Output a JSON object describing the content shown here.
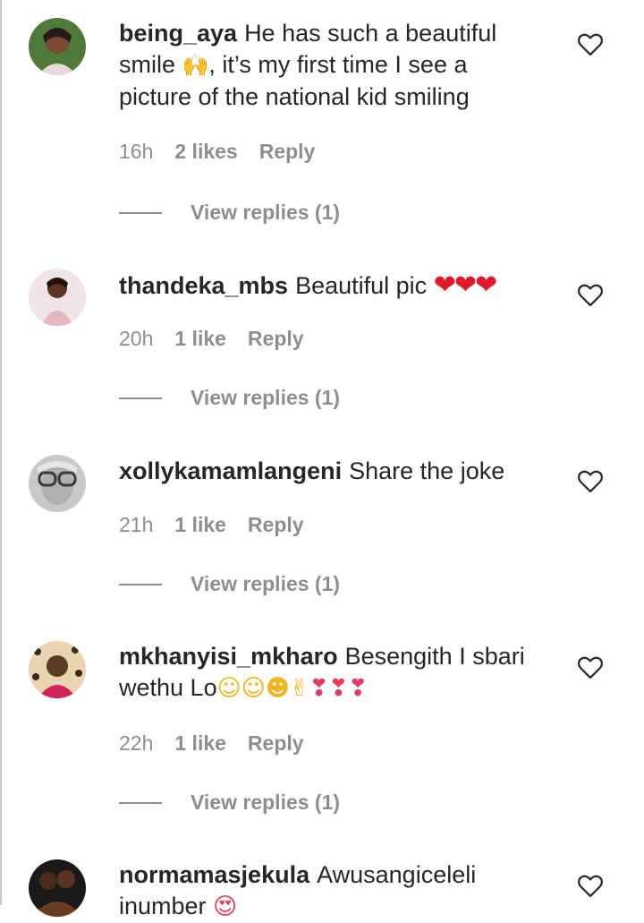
{
  "comments": [
    {
      "username": "being_aya",
      "text_1": "He has such a beautiful smile",
      "emoji": "🙌",
      "text_2": ", it’s my first time I see a picture of the national kid smiling",
      "time": "16h",
      "likes": "2 likes",
      "reply": "Reply",
      "view_replies": "View replies (1)"
    },
    {
      "username": "thandeka_mbs",
      "text_1": "Beautiful pic",
      "emoji": "❤❤❤",
      "time": "20h",
      "likes": "1 like",
      "reply": "Reply",
      "view_replies": "View replies (1)"
    },
    {
      "username": "xollykamamlangeni",
      "text_1": "Share the joke",
      "time": "21h",
      "likes": "1 like",
      "reply": "Reply",
      "view_replies": "View replies (1)"
    },
    {
      "username": "mkhanyisi_mkharo",
      "text_1": "Besengith I sbari wethu Lo",
      "emoji_faces": "☺☺",
      "emoji_laugh": "☻",
      "emoji_hand": "✌",
      "emoji_hearts": "❣❣❣",
      "time": "22h",
      "likes": "1 like",
      "reply": "Reply",
      "view_replies": "View replies (1)"
    },
    {
      "username": "normamasjekula",
      "text_1": "Awusangiceleli inumber",
      "emoji": "😍"
    }
  ],
  "icons": {
    "like": "heart-outline-icon"
  }
}
